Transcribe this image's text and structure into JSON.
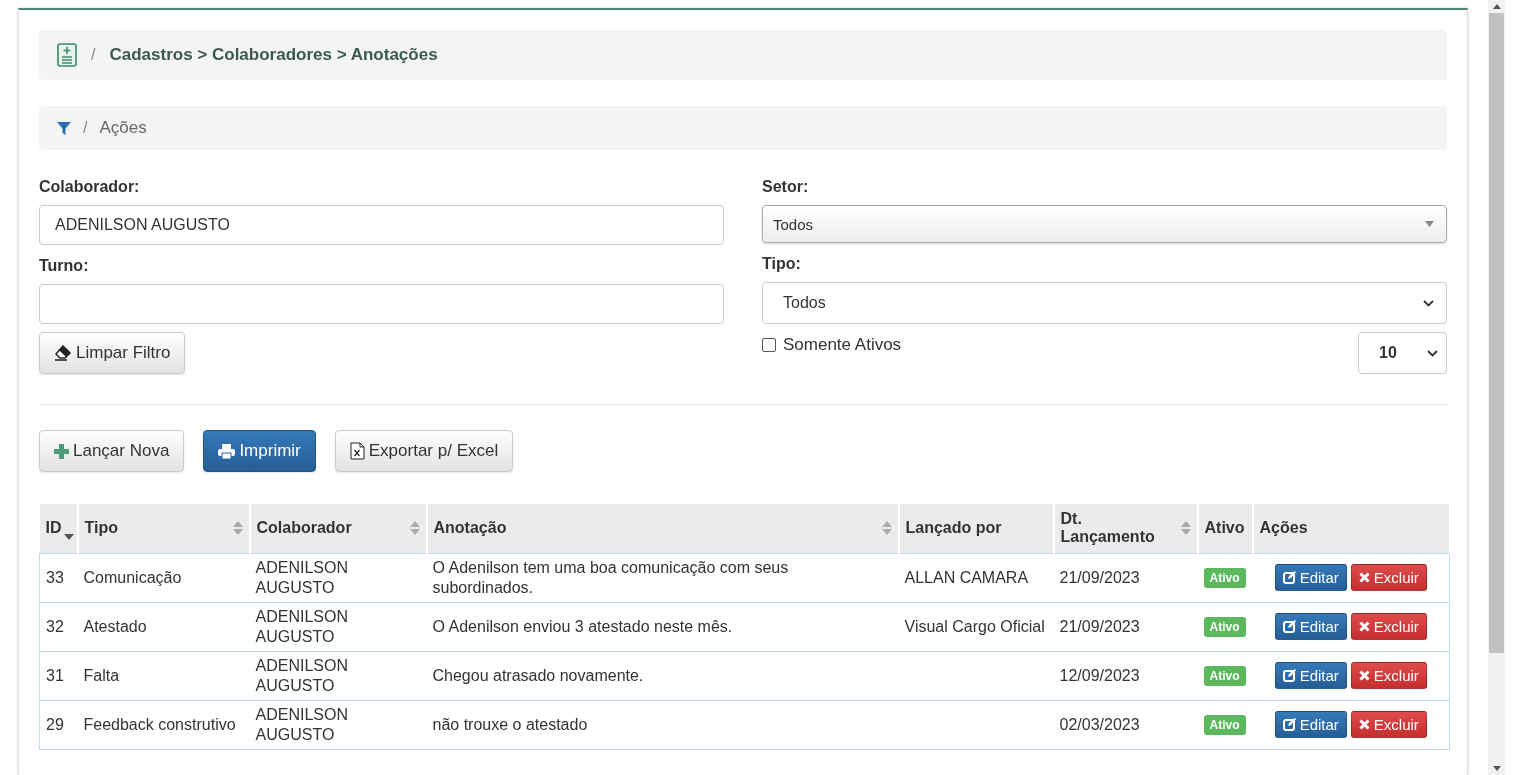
{
  "breadcrumb": {
    "separator": "/",
    "path": "Cadastros > Colaboradores > Anotações"
  },
  "filter_bar": {
    "separator": "/",
    "title": "Ações"
  },
  "filters": {
    "colaborador": {
      "label": "Colaborador:",
      "value": "ADENILSON AUGUSTO"
    },
    "setor": {
      "label": "Setor:",
      "value": "Todos"
    },
    "turno": {
      "label": "Turno:"
    },
    "tipo": {
      "label": "Tipo:",
      "value": "Todos"
    },
    "clear_button": "Limpar Filtro",
    "only_active": {
      "label": "Somente Ativos",
      "checked": false
    },
    "page_size": "10"
  },
  "actions": [
    {
      "kind": "add",
      "label": "Lançar Nova"
    },
    {
      "kind": "print",
      "label": "Imprimir"
    },
    {
      "kind": "excel",
      "label": "Exportar p/ Excel"
    }
  ],
  "table": {
    "columns": [
      {
        "label": "ID",
        "sortable": true,
        "sorted": true
      },
      {
        "label": "Tipo",
        "sortable": true,
        "sorted": false
      },
      {
        "label": "Colaborador",
        "sortable": true,
        "sorted": false
      },
      {
        "label": "Anotação",
        "sortable": true,
        "sorted": false
      },
      {
        "label": "Lançado por",
        "sortable": false
      },
      {
        "label": "Dt. Lançamento",
        "sortable": true,
        "sorted": false
      },
      {
        "label": "Ativo",
        "sortable": false
      },
      {
        "label": "Ações",
        "sortable": false
      }
    ],
    "rows": [
      {
        "id": "33",
        "tipo": "Comunicação",
        "colaborador": "ADENILSON AUGUSTO",
        "anotacao": "O Adenilson tem uma boa comunicação com seus subordinados.",
        "lancado_por": "ALLAN CAMARA",
        "data": "21/09/2023",
        "status": "Ativo",
        "active": true,
        "edit": "Editar",
        "delete": "Excluir"
      },
      {
        "id": "32",
        "tipo": "Atestado",
        "colaborador": "ADENILSON AUGUSTO",
        "anotacao": "O Adenilson enviou 3 atestado neste mês.",
        "lancado_por": "Visual Cargo Oficial",
        "data": "21/09/2023",
        "status": "Ativo",
        "active": true,
        "edit": "Editar",
        "delete": "Excluir"
      },
      {
        "id": "31",
        "tipo": "Falta",
        "colaborador": "ADENILSON AUGUSTO",
        "anotacao": "Chegou atrasado novamente.",
        "data": "12/09/2023",
        "status": "Ativo",
        "active": true,
        "edit": "Editar",
        "delete": "Excluir"
      },
      {
        "id": "29",
        "tipo": "Feedback construtivo",
        "colaborador": "ADENILSON AUGUSTO",
        "anotacao": "não trouxe o atestado",
        "data": "02/03/2023",
        "status": "Ativo",
        "active": true,
        "edit": "Editar",
        "delete": "Excluir"
      }
    ]
  }
}
